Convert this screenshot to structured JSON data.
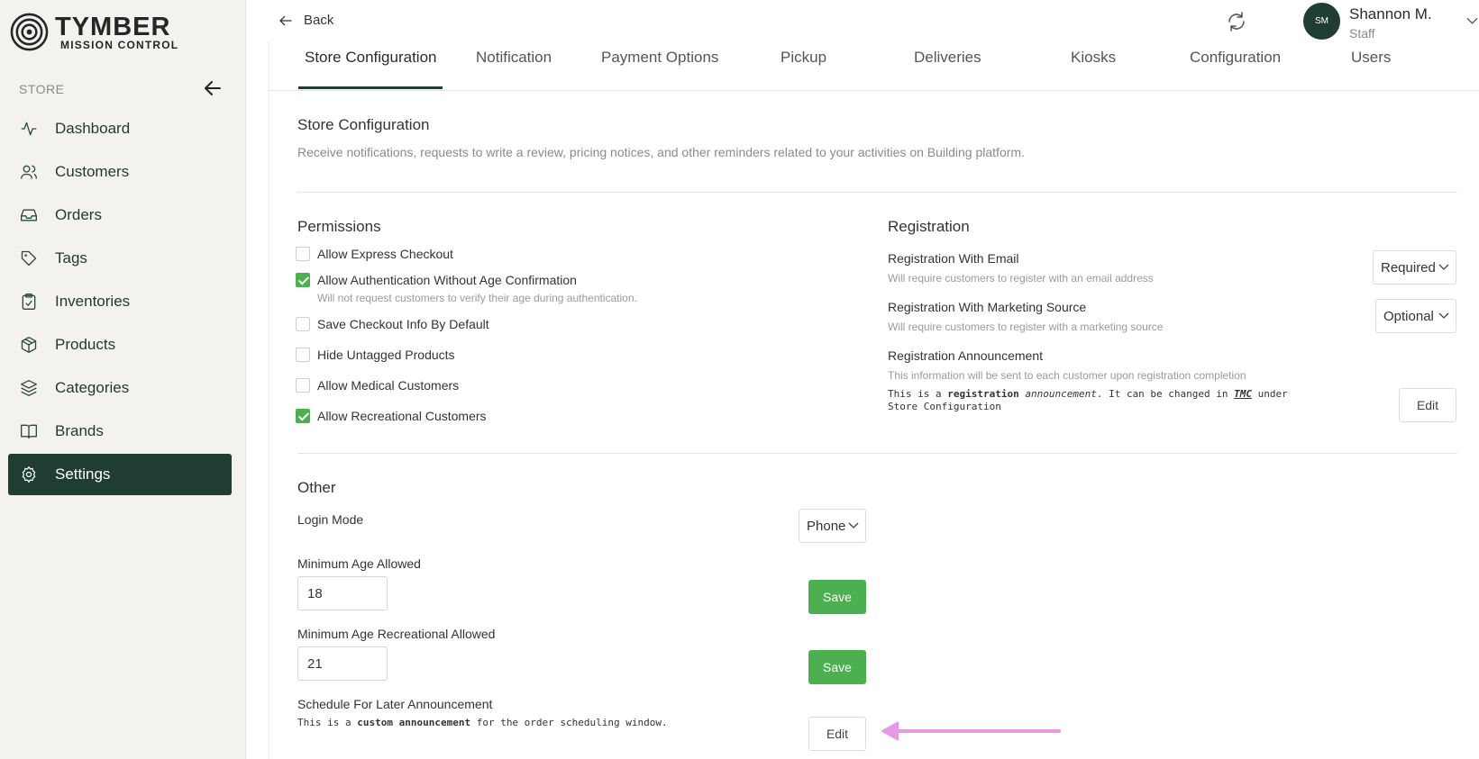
{
  "brand": {
    "name": "TYMBER",
    "subtitle": "MISSION CONTROL",
    "accent_color": "#1f3d30",
    "success_color": "#4caf50"
  },
  "sidebar": {
    "section_label": "STORE",
    "collapse_icon": "arrow-left-icon",
    "items": [
      {
        "label": "Dashboard",
        "icon": "activity-icon"
      },
      {
        "label": "Customers",
        "icon": "users-icon"
      },
      {
        "label": "Orders",
        "icon": "inbox-icon"
      },
      {
        "label": "Tags",
        "icon": "tag-icon"
      },
      {
        "label": "Inventories",
        "icon": "clipboard-icon"
      },
      {
        "label": "Products",
        "icon": "box-icon"
      },
      {
        "label": "Categories",
        "icon": "layers-icon"
      },
      {
        "label": "Brands",
        "icon": "book-icon"
      },
      {
        "label": "Settings",
        "icon": "gear-icon",
        "active": true
      }
    ]
  },
  "header": {
    "back_label": "Back",
    "user": {
      "initials": "SM",
      "name": "Shannon M.",
      "role": "Staff"
    }
  },
  "tabs": [
    {
      "label": "Store Configuration",
      "active": true
    },
    {
      "label": "Notification"
    },
    {
      "label": "Payment Options"
    },
    {
      "label": "Pickup"
    },
    {
      "label": "Deliveries"
    },
    {
      "label": "Kiosks"
    },
    {
      "label": "Configuration"
    },
    {
      "label": "Users"
    }
  ],
  "store_config": {
    "title": "Store Configuration",
    "description": "Receive notifications, requests to write a review, pricing notices, and other reminders related to your activities on Building platform."
  },
  "permissions": {
    "title": "Permissions",
    "items": [
      {
        "label": "Allow Express Checkout",
        "checked": false
      },
      {
        "label": "Allow Authentication Without Age Confirmation",
        "help": "Will not request customers to verify their age during authentication.",
        "checked": true
      },
      {
        "label": "Save Checkout Info By Default",
        "checked": false
      },
      {
        "label": "Hide Untagged Products",
        "checked": false
      },
      {
        "label": "Allow Medical Customers",
        "checked": false
      },
      {
        "label": "Allow Recreational Customers",
        "checked": true
      }
    ]
  },
  "registration": {
    "title": "Registration",
    "email": {
      "label": "Registration With Email",
      "help": "Will require customers to register with an email address",
      "value": "Required"
    },
    "marketing": {
      "label": "Registration With Marketing Source",
      "help": "Will require customers to register with a marketing source",
      "value": "Optional"
    },
    "announcement": {
      "label": "Registration Announcement",
      "help": "This information will be sent to each customer upon registration completion",
      "text_1": "This is a ",
      "text_bold": "registration",
      "text_2": " ",
      "text_italic": "announcement",
      "text_3": ". It can be changed in ",
      "text_tmc": "TMC",
      "text_4": " under",
      "text_line2": "Store Configuration",
      "edit_label": "Edit"
    }
  },
  "other": {
    "title": "Other",
    "login_mode": {
      "label": "Login Mode",
      "value": "Phone"
    },
    "min_age": {
      "label": "Minimum Age Allowed",
      "value": "18",
      "save_label": "Save"
    },
    "min_age_rec": {
      "label": "Minimum Age Recreational Allowed",
      "value": "21",
      "save_label": "Save"
    },
    "schedule": {
      "label": "Schedule For Later Announcement",
      "text_1": "This is a ",
      "text_bold": "custom announcement",
      "text_2": " for the order scheduling window.",
      "edit_label": "Edit"
    }
  },
  "annotation": {
    "arrow_color": "#e59ae6"
  }
}
